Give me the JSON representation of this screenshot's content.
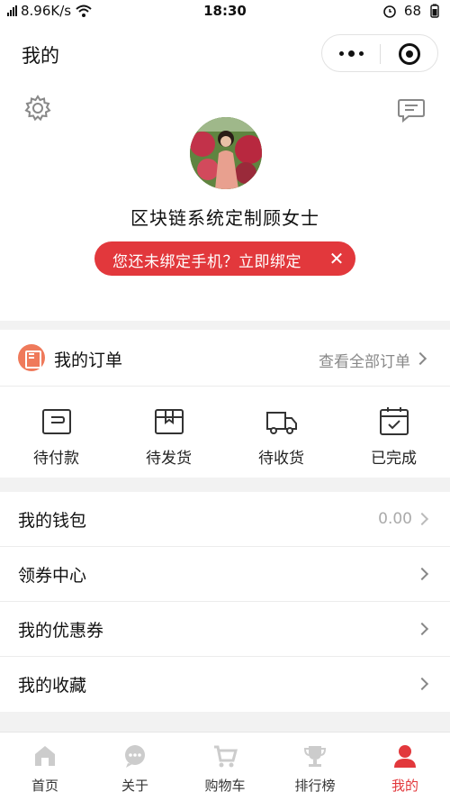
{
  "status_bar": {
    "speed": "8.96K/s",
    "time": "18:30",
    "battery": "68"
  },
  "header": {
    "title": "我的"
  },
  "profile": {
    "username": "区块链系统定制顾女士",
    "bind_prompt": "您还未绑定手机？立即绑定"
  },
  "orders": {
    "title": "我的订单",
    "view_all": "查看全部订单",
    "items": [
      {
        "label": "待付款",
        "icon": "wallet-icon"
      },
      {
        "label": "待发货",
        "icon": "package-icon"
      },
      {
        "label": "待收货",
        "icon": "truck-icon"
      },
      {
        "label": "已完成",
        "icon": "check-calendar-icon"
      }
    ]
  },
  "menu": [
    {
      "label": "我的钱包",
      "value": "0.00"
    },
    {
      "label": "领券中心"
    },
    {
      "label": "我的优惠券"
    },
    {
      "label": "我的收藏"
    }
  ],
  "tabs": [
    {
      "label": "首页",
      "icon": "home-icon"
    },
    {
      "label": "关于",
      "icon": "chat-bubble-icon"
    },
    {
      "label": "购物车",
      "icon": "cart-icon"
    },
    {
      "label": "排行榜",
      "icon": "trophy-icon"
    },
    {
      "label": "我的",
      "icon": "user-icon",
      "active": true
    }
  ],
  "colors": {
    "accent": "#e2383c",
    "order_icon": "#ef7a5b",
    "tab_inactive": "#cccccc"
  }
}
